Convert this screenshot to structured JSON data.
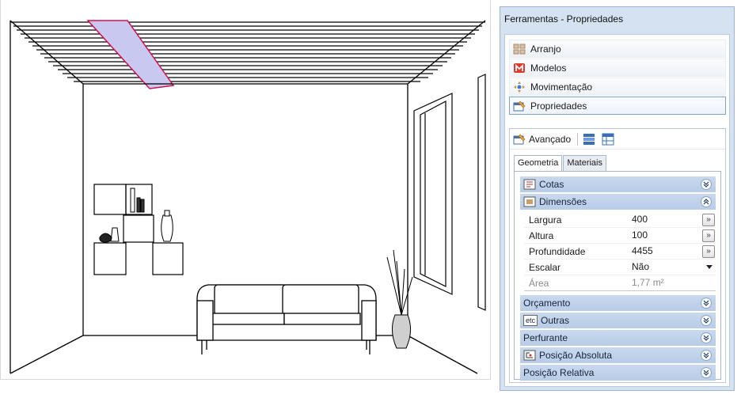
{
  "panel": {
    "title": "Ferramentas - Propriedades",
    "sections": [
      {
        "label": "Arranjo",
        "icon": "arrange-icon"
      },
      {
        "label": "Modelos",
        "icon": "models-icon"
      },
      {
        "label": "Movimentação",
        "icon": "move-icon"
      },
      {
        "label": "Propriedades",
        "icon": "properties-icon"
      }
    ],
    "advanced": {
      "label": "Avançado",
      "tabs": [
        "Geometria",
        "Materiais"
      ],
      "groups": {
        "cotas": "Cotas",
        "dimensoes": "Dimensões",
        "orcamento": "Orçamento",
        "outras": "Outras",
        "outras_icon_text": "etc",
        "perfurante": "Perfurante",
        "posicao_absoluta": "Posição Absoluta",
        "posicao_relativa": "Posição Relativa"
      },
      "properties": [
        {
          "name": "Largura",
          "value": "400",
          "button": "»"
        },
        {
          "name": "Altura",
          "value": "100",
          "button": "»"
        },
        {
          "name": "Profundidade",
          "value": "4455",
          "button": "»"
        },
        {
          "name": "Escalar",
          "value": "Não"
        },
        {
          "name": "Área",
          "value": "1,77 m²"
        }
      ]
    }
  },
  "colors": {
    "panel_bg": "#d5e2f1",
    "group_header": "#bfd1ea",
    "beam": "#c8c8f0",
    "beam_edge": "#d01050"
  }
}
